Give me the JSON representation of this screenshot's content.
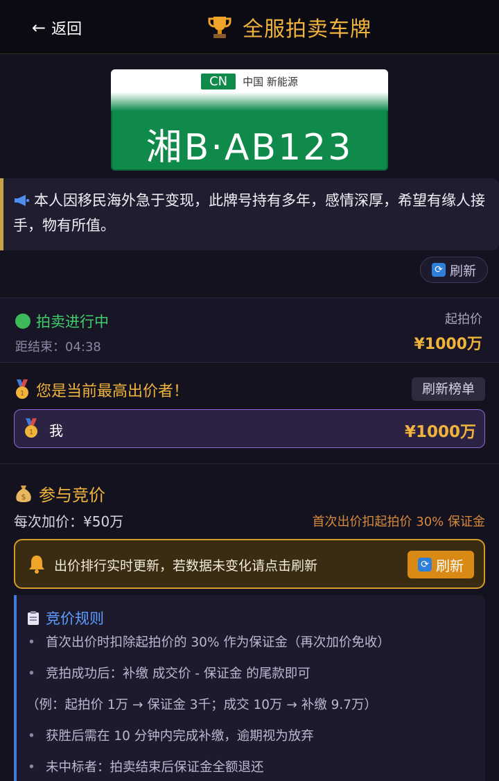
{
  "header": {
    "back_label": "返回",
    "back_arrow": "←",
    "title": "全服拍卖车牌",
    "icon": "trophy-icon"
  },
  "plate": {
    "country": "CN",
    "region": "中国 新能源",
    "number": "湘B·AB123",
    "color": "#0f8a4b"
  },
  "note": {
    "icon": "megaphone-icon",
    "text": "本人因移民海外急于变现，此牌号持有多年，感情深厚，希望有缘人接手，物有所值。"
  },
  "refresh_small_label": "刷新",
  "status": {
    "state": "拍卖进行中",
    "countdown_label": "距结束：",
    "countdown": "04:38",
    "start_price_label": "起拍价",
    "start_price": "¥1000万"
  },
  "leader": {
    "message": "您是当前最高出价者！",
    "refresh_board_label": "刷新榜单",
    "bids": [
      {
        "rank_icon": "gold-medal-icon",
        "name": "我",
        "amount": "¥1000万"
      }
    ]
  },
  "bidding": {
    "title": "参与竞价",
    "increment": "每次加价：¥50万",
    "deposit_note": "首次出价扣起拍价 30% 保证金",
    "alert": "出价排行实时更新，若数据未变化请点击刷新",
    "alert_button": "刷新"
  },
  "rules": {
    "title": "竞价规则",
    "items": [
      {
        "bullet": "•",
        "text": "首次出价时扣除起拍价的 30% 作为保证金（再次加价免收）"
      },
      {
        "bullet": "•",
        "text": "竞拍成功后：补缴 成交价 - 保证金 的尾款即可"
      },
      {
        "bullet": "",
        "text": "（例：起拍价 1万 → 保证金 3千；成交 10万 → 补缴 9.7万）"
      },
      {
        "bullet": "•",
        "text": "获胜后需在 10 分钟内完成补缴，逾期视为放弃"
      },
      {
        "bullet": "•",
        "text": "未中标者：拍卖结束后保证金全额退还"
      }
    ]
  },
  "colors": {
    "accent_gold": "#f0b43c",
    "live_green": "#3fcf6a",
    "rules_blue": "#5f9dff",
    "alert_orange": "#d88a14"
  }
}
